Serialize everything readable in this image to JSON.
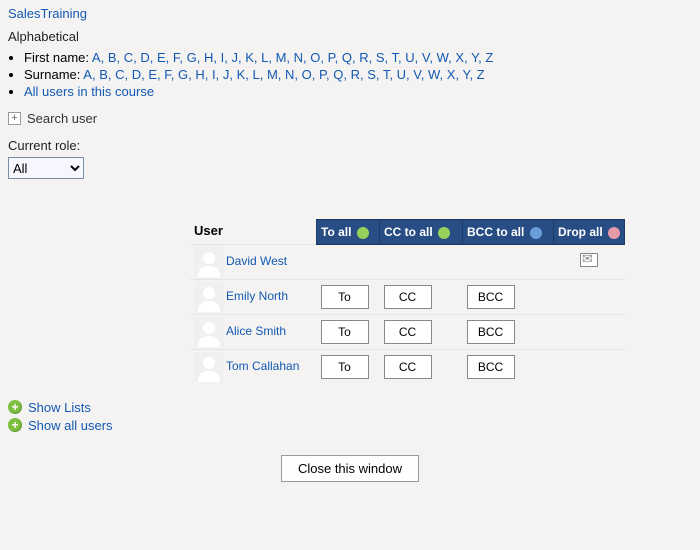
{
  "breadcrumb": "SalesTraining",
  "alpha": {
    "heading": "Alphabetical",
    "first_label": "First name:",
    "surname_label": "Surname:",
    "letters": [
      "A",
      "B",
      "C",
      "D",
      "E",
      "F",
      "G",
      "H",
      "I",
      "J",
      "K",
      "L",
      "M",
      "N",
      "O",
      "P",
      "Q",
      "R",
      "S",
      "T",
      "U",
      "V",
      "W",
      "X",
      "Y",
      "Z"
    ],
    "all_users_link": "All users in this course"
  },
  "search": {
    "label": "Search user"
  },
  "role": {
    "label": "Current role:",
    "selected": "All",
    "options": [
      "All"
    ]
  },
  "table": {
    "user_header": "User",
    "to_all": "To all",
    "cc_all": "CC to all",
    "bcc_all": "BCC to all",
    "drop_all": "Drop all",
    "to_btn": "To",
    "cc_btn": "CC",
    "bcc_btn": "BCC",
    "rows": [
      {
        "name": "David West",
        "buttons": false,
        "mail": true
      },
      {
        "name": "Emily North",
        "buttons": true,
        "mail": false
      },
      {
        "name": "Alice Smith",
        "buttons": true,
        "mail": false
      },
      {
        "name": "Tom Callahan",
        "buttons": true,
        "mail": false
      }
    ]
  },
  "links": {
    "show_lists": "Show Lists",
    "show_all_users": "Show all users"
  },
  "close_button": "Close this window"
}
